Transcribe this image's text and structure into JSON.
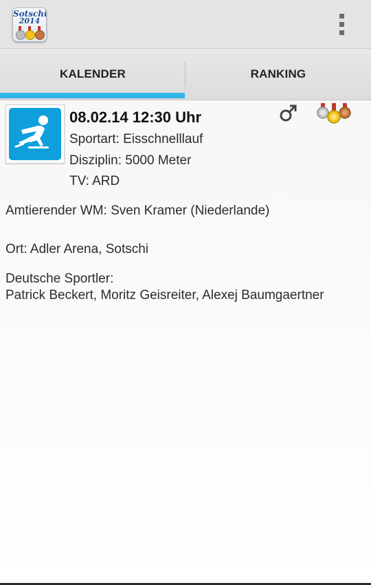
{
  "app": {
    "logo_line1": "Sotschi",
    "logo_line2": "2014"
  },
  "tabs": [
    {
      "label": "KALENDER",
      "selected": true
    },
    {
      "label": "RANKING",
      "selected": false
    }
  ],
  "event": {
    "sport_icon": "speed-skating-icon",
    "date_time": "08.02.14 12:30 Uhr",
    "sportart": "Sportart: Eisschnelllauf",
    "disziplin": "Disziplin: 5000 Meter",
    "tv": "TV: ARD",
    "gender_icon": "male-symbol-icon",
    "medals_icon": "medals-icon",
    "amtierender_wm": "Amtierender WM: Sven Kramer (Niederlande)",
    "ort": "Ort: Adler Arena, Sotschi",
    "deutsche_sportler_label": "Deutsche Sportler:",
    "deutsche_sportler_names": "Patrick Beckert, Moritz Geisreiter, Alexej Baumgaertner"
  },
  "colors": {
    "accent": "#33b5e5",
    "sport_icon_bg": "#0e9fdc",
    "action_bar": "#e4e4e4",
    "gold": "#f2c318",
    "silver": "#b8b8b8",
    "bronze": "#c7773e"
  }
}
